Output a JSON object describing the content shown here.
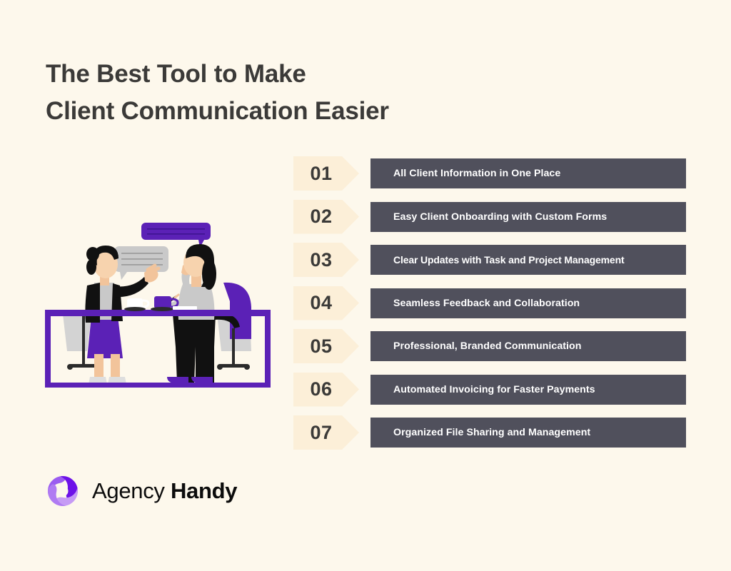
{
  "page": {
    "background_color": "#FDF8EC",
    "heading_color": "#3B3A38",
    "accent_purple": "#5B21B6",
    "bar_color": "#50505C",
    "badge_color": "#FCEFD8"
  },
  "heading": {
    "line1": "The Best Tool to Make",
    "line2": "Client Communication Easier"
  },
  "features": [
    {
      "number": "01",
      "label": "All Client Information in One Place"
    },
    {
      "number": "02",
      "label": "Easy Client Onboarding with Custom Forms"
    },
    {
      "number": "03",
      "label": "Clear Updates with Task and Project Management"
    },
    {
      "number": "04",
      "label": "Seamless Feedback and Collaboration"
    },
    {
      "number": "05",
      "label": "Professional, Branded Communication"
    },
    {
      "number": "06",
      "label": "Automated Invoicing for Faster Payments"
    },
    {
      "number": "07",
      "label": "Organized File Sharing and Management"
    }
  ],
  "logo": {
    "name_light": "Agency",
    "name_bold": "Handy",
    "mark_colors": {
      "lobe_top": "#9B5CF0",
      "lobe_right": "#6D12E8",
      "lobe_bottom": "#C69BF5"
    }
  },
  "illustration": {
    "title": "two-women-meeting-at-desk",
    "speech_bubble_purple_lines": 2,
    "speech_bubble_gray_lines": 3,
    "colors": {
      "purple": "#5B21B6",
      "gray": "#C9C9C9",
      "dark": "#111111",
      "skin": "#F2C49B",
      "light_gray": "#D3D3D3"
    }
  }
}
